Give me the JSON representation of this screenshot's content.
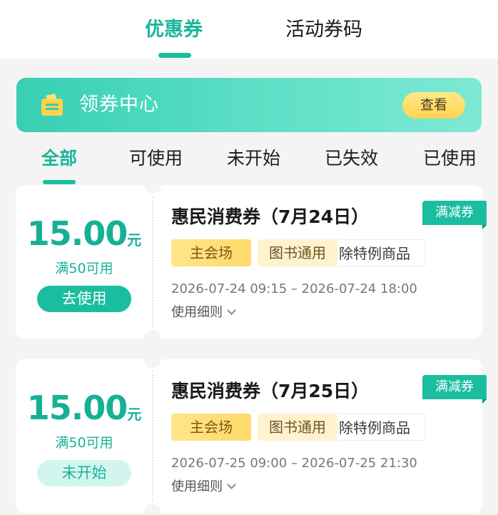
{
  "top_tabs": {
    "coupons": "优惠券",
    "activity_codes": "活动券码"
  },
  "banner": {
    "title": "领券中心",
    "button": "查看",
    "icon": "coupon-ticket-icon"
  },
  "filter_tabs": [
    {
      "label": "全部",
      "active": true
    },
    {
      "label": "可使用",
      "active": false
    },
    {
      "label": "未开始",
      "active": false
    },
    {
      "label": "已失效",
      "active": false
    },
    {
      "label": "已使用",
      "active": false
    }
  ],
  "coupons": [
    {
      "amount": "15.00",
      "unit": "元",
      "threshold": "满50可用",
      "action": "去使用",
      "action_state": "available",
      "title": "惠民消费券（7月24日）",
      "type_badge": "满减券",
      "tags": [
        "主会场",
        "图书通用",
        "除特例商品"
      ],
      "start": "2026-07-24 09:15",
      "end": "2026-07-24 18:00",
      "details": "使用细则"
    },
    {
      "amount": "15.00",
      "unit": "元",
      "threshold": "满50可用",
      "action": "未开始",
      "action_state": "not_started",
      "title": "惠民消费券（7月25日）",
      "type_badge": "满减券",
      "tags": [
        "主会场",
        "图书通用",
        "除特例商品"
      ],
      "start": "2026-07-25 09:00",
      "end": "2026-07-25 21:30",
      "details": "使用细则"
    }
  ],
  "colors": {
    "accent": "#1bbd9f",
    "banner_button": "#ffd352",
    "page_bg": "#f4f4f4"
  }
}
